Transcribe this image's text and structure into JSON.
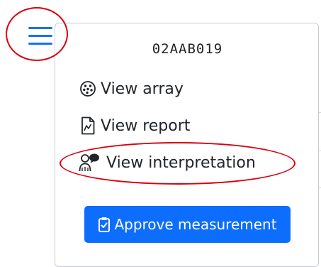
{
  "menu": {
    "toggle_icon": "hamburger-menu-icon"
  },
  "dropdown": {
    "sample_id": "02AAB019",
    "items": [
      {
        "label": "View array",
        "icon": "array-icon"
      },
      {
        "label": "View report",
        "icon": "report-icon"
      },
      {
        "label": "View interpretation",
        "icon": "interpretation-icon"
      }
    ],
    "approve": {
      "label": "Approve measurement",
      "icon": "clipboard-check-icon"
    }
  },
  "colors": {
    "accent": "#0d6efd",
    "hamburger": "#1a73e8",
    "annotation": "#d9000d"
  }
}
